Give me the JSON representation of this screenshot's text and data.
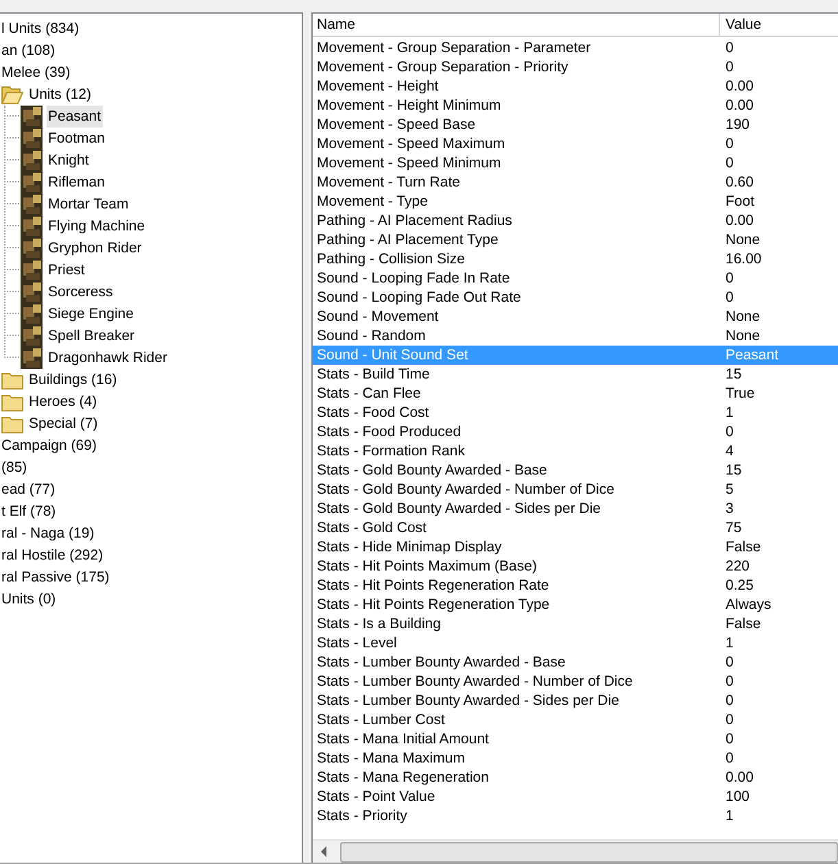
{
  "tree": [
    {
      "label": "l Units (834)",
      "selected": false
    },
    {
      "label": "an (108)",
      "selected": false,
      "children": [
        {
          "label": "Melee (39)",
          "selected": false,
          "children": [
            {
              "label": "Units (12)",
              "kind": "folder",
              "selected": false,
              "expanded": true,
              "children": [
                {
                  "label": "Peasant",
                  "kind": "unit",
                  "selected": true
                },
                {
                  "label": "Footman",
                  "kind": "unit",
                  "selected": false
                },
                {
                  "label": "Knight",
                  "kind": "unit",
                  "selected": false
                },
                {
                  "label": "Rifleman",
                  "kind": "unit",
                  "selected": false
                },
                {
                  "label": "Mortar Team",
                  "kind": "unit",
                  "selected": false
                },
                {
                  "label": "Flying Machine",
                  "kind": "unit",
                  "selected": false
                },
                {
                  "label": "Gryphon Rider",
                  "kind": "unit",
                  "selected": false
                },
                {
                  "label": "Priest",
                  "kind": "unit",
                  "selected": false
                },
                {
                  "label": "Sorceress",
                  "kind": "unit",
                  "selected": false
                },
                {
                  "label": "Siege Engine",
                  "kind": "unit",
                  "selected": false
                },
                {
                  "label": "Spell Breaker",
                  "kind": "unit",
                  "selected": false
                },
                {
                  "label": "Dragonhawk Rider",
                  "kind": "unit",
                  "selected": false
                }
              ]
            },
            {
              "label": "Buildings (16)",
              "kind": "folder",
              "selected": false,
              "expanded": false
            },
            {
              "label": "Heroes (4)",
              "kind": "folder",
              "selected": false,
              "expanded": false
            },
            {
              "label": "Special (7)",
              "kind": "folder",
              "selected": false,
              "expanded": false
            }
          ]
        },
        {
          "label": "Campaign (69)",
          "selected": false
        }
      ]
    },
    {
      "label": "(85)",
      "selected": false
    },
    {
      "label": "ead (77)",
      "selected": false
    },
    {
      "label": "t Elf (78)",
      "selected": false
    },
    {
      "label": "ral - Naga (19)",
      "selected": false
    },
    {
      "label": "ral Hostile (292)",
      "selected": false
    },
    {
      "label": "ral Passive (175)",
      "selected": false
    },
    {
      "label": "Units (0)",
      "selected": false
    }
  ],
  "table": {
    "columns": [
      "Name",
      "Value"
    ],
    "rows": [
      {
        "name": "Movement - Group Separation - Parameter",
        "value": "0",
        "selected": false
      },
      {
        "name": "Movement - Group Separation - Priority",
        "value": "0",
        "selected": false
      },
      {
        "name": "Movement - Height",
        "value": "0.00",
        "selected": false
      },
      {
        "name": "Movement - Height Minimum",
        "value": "0.00",
        "selected": false
      },
      {
        "name": "Movement - Speed Base",
        "value": "190",
        "selected": false
      },
      {
        "name": "Movement - Speed Maximum",
        "value": "0",
        "selected": false
      },
      {
        "name": "Movement - Speed Minimum",
        "value": "0",
        "selected": false
      },
      {
        "name": "Movement - Turn Rate",
        "value": "0.60",
        "selected": false
      },
      {
        "name": "Movement - Type",
        "value": "Foot",
        "selected": false
      },
      {
        "name": "Pathing - AI Placement Radius",
        "value": "0.00",
        "selected": false
      },
      {
        "name": "Pathing - AI Placement Type",
        "value": "None",
        "selected": false
      },
      {
        "name": "Pathing - Collision Size",
        "value": "16.00",
        "selected": false
      },
      {
        "name": "Sound - Looping Fade In Rate",
        "value": "0",
        "selected": false
      },
      {
        "name": "Sound - Looping Fade Out Rate",
        "value": "0",
        "selected": false
      },
      {
        "name": "Sound - Movement",
        "value": "None",
        "selected": false
      },
      {
        "name": "Sound - Random",
        "value": "None",
        "selected": false
      },
      {
        "name": "Sound - Unit Sound Set",
        "value": "Peasant",
        "selected": true
      },
      {
        "name": "Stats - Build Time",
        "value": "15",
        "selected": false
      },
      {
        "name": "Stats - Can Flee",
        "value": "True",
        "selected": false
      },
      {
        "name": "Stats - Food Cost",
        "value": "1",
        "selected": false
      },
      {
        "name": "Stats - Food Produced",
        "value": "0",
        "selected": false
      },
      {
        "name": "Stats - Formation Rank",
        "value": "4",
        "selected": false
      },
      {
        "name": "Stats - Gold Bounty Awarded - Base",
        "value": "15",
        "selected": false
      },
      {
        "name": "Stats - Gold Bounty Awarded - Number of Dice",
        "value": "5",
        "selected": false
      },
      {
        "name": "Stats - Gold Bounty Awarded - Sides per Die",
        "value": "3",
        "selected": false
      },
      {
        "name": "Stats - Gold Cost",
        "value": "75",
        "selected": false
      },
      {
        "name": "Stats - Hide Minimap Display",
        "value": "False",
        "selected": false
      },
      {
        "name": "Stats - Hit Points Maximum (Base)",
        "value": "220",
        "selected": false
      },
      {
        "name": "Stats - Hit Points Regeneration Rate",
        "value": "0.25",
        "selected": false
      },
      {
        "name": "Stats - Hit Points Regeneration Type",
        "value": "Always",
        "selected": false
      },
      {
        "name": "Stats - Is a Building",
        "value": "False",
        "selected": false
      },
      {
        "name": "Stats - Level",
        "value": "1",
        "selected": false
      },
      {
        "name": "Stats - Lumber Bounty Awarded - Base",
        "value": "0",
        "selected": false
      },
      {
        "name": "Stats - Lumber Bounty Awarded - Number of Dice",
        "value": "0",
        "selected": false
      },
      {
        "name": "Stats - Lumber Bounty Awarded - Sides per Die",
        "value": "0",
        "selected": false
      },
      {
        "name": "Stats - Lumber Cost",
        "value": "0",
        "selected": false
      },
      {
        "name": "Stats - Mana Initial Amount",
        "value": "0",
        "selected": false
      },
      {
        "name": "Stats - Mana Maximum",
        "value": "0",
        "selected": false
      },
      {
        "name": "Stats - Mana Regeneration",
        "value": "0.00",
        "selected": false
      },
      {
        "name": "Stats - Point Value",
        "value": "100",
        "selected": false
      },
      {
        "name": "Stats - Priority",
        "value": "1",
        "selected": false
      }
    ]
  }
}
